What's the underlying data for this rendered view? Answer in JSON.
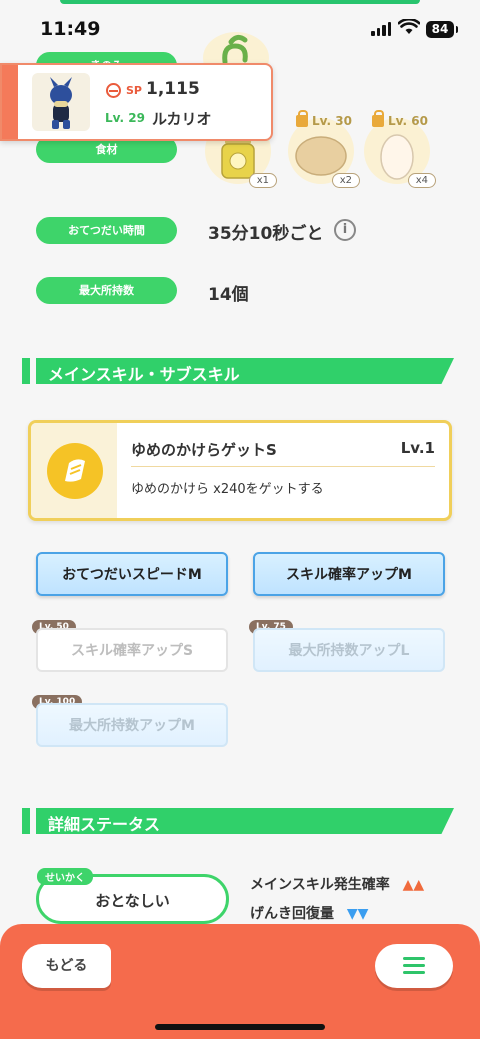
{
  "status": {
    "time": "11:49",
    "battery": "84"
  },
  "fields": {
    "berry_label": "きのみ",
    "ingredient_label": "食材",
    "help_time_label": "おてつだい時間",
    "help_time_value": "35分10秒ごと",
    "carry_label": "最大所持数",
    "carry_value": "14個"
  },
  "ingredients": [
    {
      "count": "x1"
    },
    {
      "unlock": "Lv. 30",
      "count": "x2"
    },
    {
      "unlock": "Lv. 60",
      "count": "x4"
    }
  ],
  "pokemon_card": {
    "sp_label": "SP",
    "sp_value": "1,115",
    "level": "Lv. 29",
    "name": "ルカリオ"
  },
  "sections": {
    "skills_title": "メインスキル・サブスキル",
    "detail_title": "詳細ステータス"
  },
  "main_skill": {
    "name": "ゆめのかけらゲットS",
    "level": "Lv.1",
    "description": "ゆめのかけら x240をゲットする"
  },
  "sub_skills": [
    {
      "label": "おてつだいスピードM"
    },
    {
      "label": "スキル確率アップM"
    },
    {
      "label": "スキル確率アップS",
      "unlock": "Lv. 50"
    },
    {
      "label": "最大所持数アップL",
      "unlock": "Lv. 75"
    },
    {
      "label": "最大所持数アップM",
      "unlock": "Lv. 100"
    }
  ],
  "nature": {
    "tag": "せいかく",
    "value": "おとなしい",
    "effects": [
      {
        "label": "メインスキル発生確率",
        "arrows": "▲▲",
        "color": "#f06a3c"
      },
      {
        "label": "げんき回復量",
        "arrows": "▼▼",
        "color": "#3b9ef0"
      }
    ]
  },
  "bottom": {
    "back_label": "もどる"
  },
  "colors": {
    "accent_green": "#30d06a",
    "bottom_bar": "#f56b4c"
  }
}
